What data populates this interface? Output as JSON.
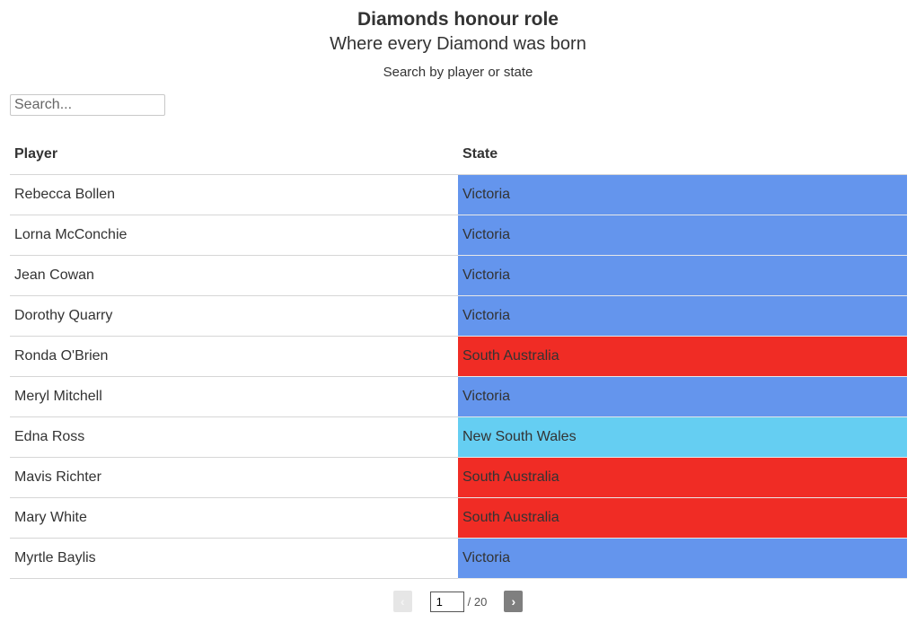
{
  "header": {
    "title": "Diamonds honour role",
    "subtitle": "Where every Diamond was born",
    "description": "Search by player or state"
  },
  "search": {
    "placeholder": "Search...",
    "value": ""
  },
  "table": {
    "columns": [
      "Player",
      "State"
    ],
    "state_colors": {
      "Victoria": "#6495ED",
      "South Australia": "#F02C25",
      "New South Wales": "#65CEF2"
    },
    "rows": [
      {
        "player": "Rebecca Bollen",
        "state": "Victoria"
      },
      {
        "player": "Lorna McConchie",
        "state": "Victoria"
      },
      {
        "player": "Jean Cowan",
        "state": "Victoria"
      },
      {
        "player": "Dorothy Quarry",
        "state": "Victoria"
      },
      {
        "player": "Ronda O'Brien",
        "state": "South Australia"
      },
      {
        "player": "Meryl Mitchell",
        "state": "Victoria"
      },
      {
        "player": "Edna Ross",
        "state": "New South Wales"
      },
      {
        "player": "Mavis Richter",
        "state": "South Australia"
      },
      {
        "player": "Mary White",
        "state": "South Australia"
      },
      {
        "player": "Myrtle Baylis",
        "state": "Victoria"
      }
    ]
  },
  "pagination": {
    "prev_icon": "‹",
    "next_icon": "›",
    "current_page": "1",
    "total_label": "/ 20"
  }
}
